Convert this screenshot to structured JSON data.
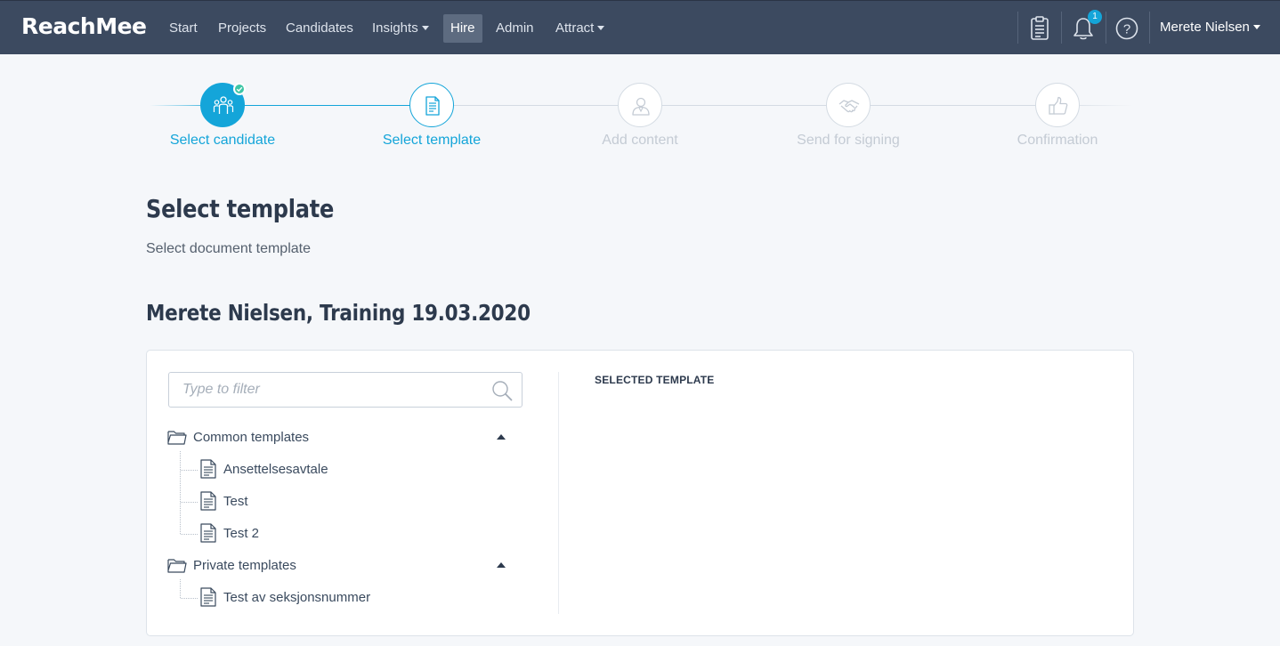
{
  "app": {
    "logo": "ReachMee"
  },
  "nav": {
    "items": [
      {
        "label": "Start"
      },
      {
        "label": "Projects"
      },
      {
        "label": "Candidates"
      },
      {
        "label": "Insights"
      },
      {
        "label": "Hire"
      },
      {
        "label": "Admin"
      },
      {
        "label": "Attract"
      }
    ],
    "active": "Hire",
    "icons": [
      "clipboard-icon",
      "bell-icon",
      "help-icon"
    ],
    "notification_count": "1",
    "user_name": "Merete Nielsen"
  },
  "stepper": {
    "steps": [
      {
        "label": "Select candidate",
        "state": "done",
        "icon": "candidates-icon"
      },
      {
        "label": "Select template",
        "state": "current",
        "icon": "document-icon"
      },
      {
        "label": "Add content",
        "state": "upcoming",
        "icon": "person-icon"
      },
      {
        "label": "Send for signing",
        "state": "upcoming",
        "icon": "handshake-icon"
      },
      {
        "label": "Confirmation",
        "state": "upcoming",
        "icon": "thumbs-up-icon"
      }
    ]
  },
  "page": {
    "title": "Select template",
    "subtitle": "Select document template",
    "project_title": "Merete Nielsen, Training 19.03.2020"
  },
  "filter": {
    "placeholder": "Type to filter"
  },
  "templates": {
    "groups": [
      {
        "label": "Common templates",
        "expanded": true,
        "items": [
          "Ansettelsesavtale",
          "Test",
          "Test 2"
        ]
      },
      {
        "label": "Private templates",
        "expanded": true,
        "items": [
          "Test av seksjonsnummer"
        ]
      }
    ]
  },
  "selected_panel": {
    "heading": "SELECTED TEMPLATE"
  },
  "colors": {
    "nav_bg": "#3c4a60",
    "accent": "#14a5d9",
    "check": "#3ec6a6",
    "page_bg": "#f5f7fa"
  }
}
